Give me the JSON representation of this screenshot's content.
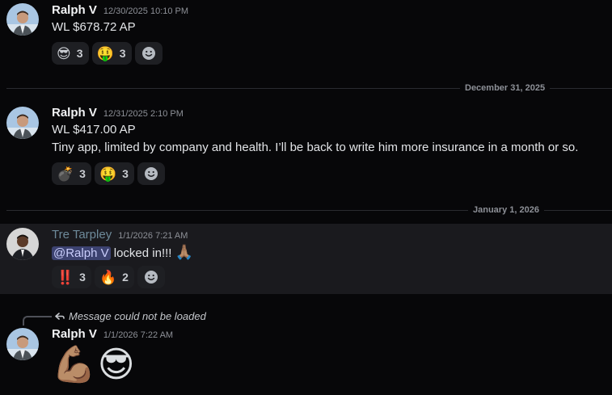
{
  "messages": [
    {
      "author": "Ralph V",
      "timestamp": "12/30/2025 10:10 PM",
      "lines": [
        "WL $678.72 AP"
      ],
      "reactions": [
        {
          "emoji": "😎",
          "count": "3"
        },
        {
          "emoji": "🤑",
          "count": "3"
        }
      ]
    },
    {
      "author": "Ralph V",
      "timestamp": "12/31/2025 2:10 PM",
      "lines": [
        "WL $417.00 AP",
        "Tiny app, limited by company and health. I’ll be back to write him more insurance in a month or so."
      ],
      "reactions": [
        {
          "emoji": "💣",
          "count": "3"
        },
        {
          "emoji": "🤑",
          "count": "3"
        }
      ]
    },
    {
      "author": "Tre Tarpley",
      "timestamp": "1/1/2026 7:21 AM",
      "mention": "@Ralph V",
      "text": " locked in!!!",
      "text_emoji": "🙏🏽",
      "reactions": [
        {
          "emoji": "‼️",
          "count": "3"
        },
        {
          "emoji": "🔥",
          "count": "2"
        }
      ]
    },
    {
      "author": "Ralph V",
      "timestamp": "1/1/2026 7:22 AM",
      "reply_text": "Message could not be loaded",
      "big_emoji": "💪🏽😎"
    }
  ],
  "dividers": [
    "December 31, 2025",
    "January 1, 2026"
  ],
  "icons": {
    "add_reaction": "smiley-add-icon",
    "reply": "reply-arrow-icon"
  },
  "colors": {
    "background": "#070709",
    "highlight": "#1a1a1e",
    "mention_bg": "#3c4270",
    "tre_name": "#6e8a9a"
  }
}
